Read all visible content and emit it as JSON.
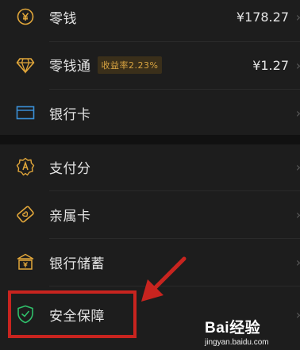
{
  "wallet": {
    "items": [
      {
        "label": "零钱",
        "value": "¥178.27",
        "icon": "yuan-coin-icon"
      },
      {
        "label": "零钱通",
        "badge": "收益率2.23%",
        "value": "¥1.27",
        "icon": "diamond-icon"
      },
      {
        "label": "银行卡",
        "icon": "bank-card-icon"
      }
    ]
  },
  "services": {
    "items": [
      {
        "label": "支付分",
        "icon": "score-badge-icon"
      },
      {
        "label": "亲属卡",
        "icon": "family-card-icon"
      },
      {
        "label": "银行储蓄",
        "icon": "bank-savings-icon"
      },
      {
        "label": "安全保障",
        "icon": "shield-check-icon"
      }
    ]
  },
  "watermark": {
    "brand": "Bai经验",
    "url": "jingyan.baidu.com"
  },
  "colors": {
    "accent_gold": "#e2a73a",
    "accent_blue": "#3a8fd6",
    "accent_green": "#2fbf6a",
    "highlight_red": "#c8241f"
  }
}
